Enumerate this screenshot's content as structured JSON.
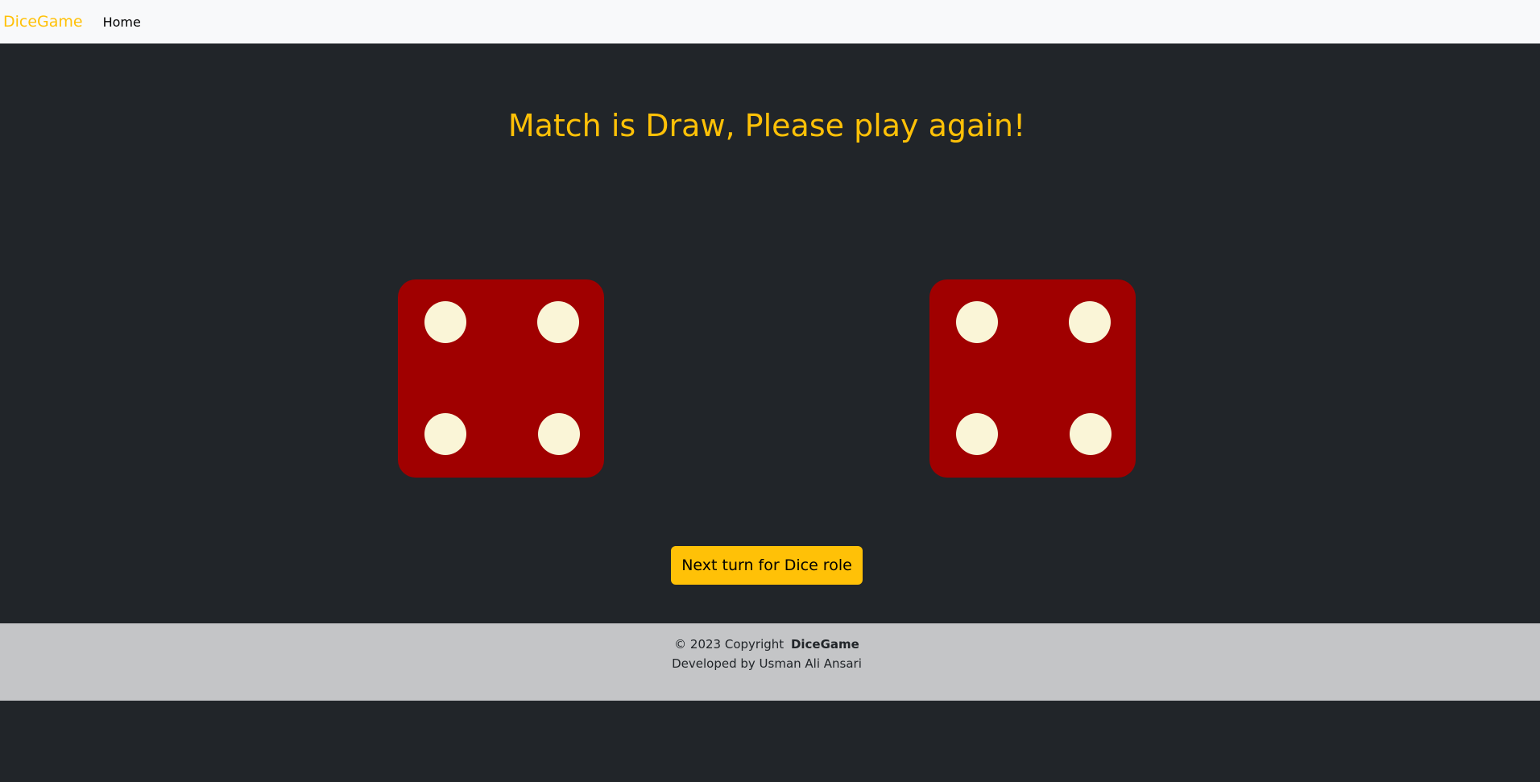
{
  "navbar": {
    "brand": "DiceGame",
    "home_link": "Home"
  },
  "main": {
    "headline": "Match is Draw, Please play again!",
    "dice": [
      {
        "value": 4,
        "label": "dice-4"
      },
      {
        "value": 4,
        "label": "dice-4"
      }
    ],
    "roll_button": "Next turn for Dice role"
  },
  "footer": {
    "copyright": "© 2023 Copyright",
    "brand": "DiceGame",
    "developer": "Developed by Usman Ali Ansari"
  },
  "colors": {
    "accent": "#ffc107",
    "dark_bg": "#212529",
    "dice_face": "#a00000",
    "pip": "#faf5d7",
    "navbar_bg": "#f8f9fa",
    "footer_bg": "#c4c5c7"
  }
}
